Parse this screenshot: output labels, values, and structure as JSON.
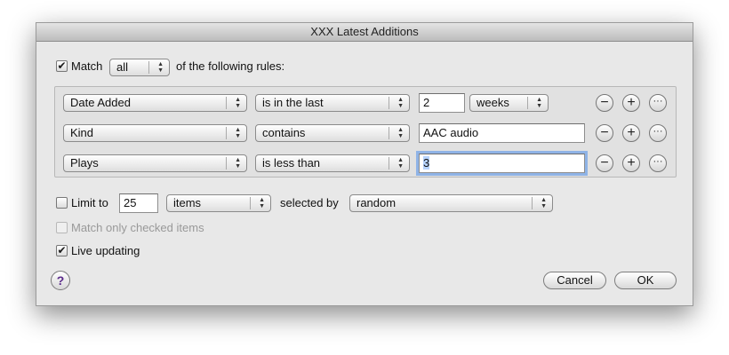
{
  "window": {
    "title": "XXX Latest Additions"
  },
  "match": {
    "checked": "✔",
    "label": "Match",
    "mode": "all",
    "suffix": "of the following rules:"
  },
  "rules": [
    {
      "field": "Date Added",
      "operator": "is in the last",
      "value": "2",
      "unit": "weeks"
    },
    {
      "field": "Kind",
      "operator": "contains",
      "value": "AAC audio"
    },
    {
      "field": "Plays",
      "operator": "is less than",
      "value": "3"
    }
  ],
  "rule_buttons": {
    "remove": "−",
    "add": "+",
    "more": "···"
  },
  "limit": {
    "label": "Limit to",
    "value": "25",
    "unit": "items",
    "selected_by_label": "selected by",
    "selected_by": "random"
  },
  "match_only_checked": {
    "label": "Match only checked items"
  },
  "live_updating": {
    "checked": "✔",
    "label": "Live updating"
  },
  "buttons": {
    "help": "?",
    "cancel": "Cancel",
    "ok": "OK"
  },
  "popup_arrows": "▲▼"
}
